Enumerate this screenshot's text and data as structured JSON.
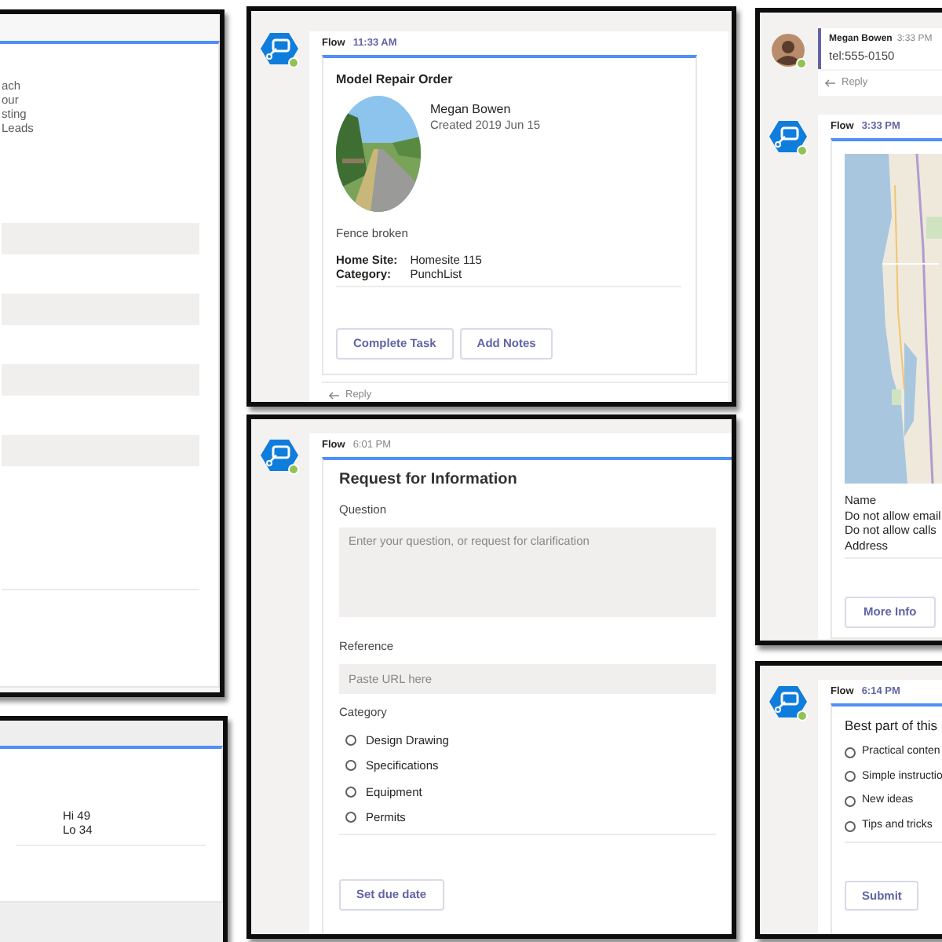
{
  "left_card": {
    "text_lines": [
      "ach",
      "our",
      "sting",
      "Leads"
    ],
    "fields": [
      {
        "kind": "input"
      },
      {
        "kind": "input"
      },
      {
        "kind": "input"
      },
      {
        "kind": "input"
      }
    ]
  },
  "weather_card": {
    "lines": [
      "Hi 49",
      "Lo 34"
    ]
  },
  "repair_card": {
    "sender": "Flow",
    "time": "11:33 AM",
    "time_highlighted": true,
    "title": "Model Repair Order",
    "person": "Megan Bowen",
    "created": "Created 2019 Jun 15",
    "description": "Fence broken",
    "facts": [
      {
        "label": "Home Site:",
        "value": "Homesite 115"
      },
      {
        "label": "Category:",
        "value": "PunchList"
      }
    ],
    "buttons": [
      "Complete Task",
      "Add Notes"
    ],
    "reply": "Reply"
  },
  "rfi_card": {
    "sender": "Flow",
    "time": "6:01 PM",
    "time_highlighted": false,
    "title": "Request for Information",
    "question_label": "Question",
    "question_placeholder": "Enter your question, or request for clarification",
    "reference_label": "Reference",
    "reference_placeholder": "Paste URL here",
    "category_label": "Category",
    "options": [
      {
        "label": "Design Drawing",
        "selected": false
      },
      {
        "label": "Specifications",
        "selected": false
      },
      {
        "label": "Equipment",
        "selected": false
      },
      {
        "label": "Permits",
        "selected": false
      }
    ],
    "button": "Set due date"
  },
  "contact_card": {
    "message": {
      "author": "Megan Bowen",
      "time": "3:33 PM",
      "text": "tel:555-0150",
      "reply": "Reply"
    },
    "sender": "Flow",
    "time": "3:33 PM",
    "time_highlighted": true,
    "lines": [
      "Name",
      "Do not allow email",
      "Do not allow calls",
      "Address"
    ],
    "button": "More Info"
  },
  "survey_card": {
    "sender": "Flow",
    "time": "6:14 PM",
    "time_highlighted": true,
    "title": "Best part of this",
    "options": [
      {
        "label": "Practical conten",
        "selected": false
      },
      {
        "label": "Simple instructio",
        "selected": false
      },
      {
        "label": "New ideas",
        "selected": false
      },
      {
        "label": "Tips and tricks",
        "selected": false
      }
    ],
    "button": "Submit"
  }
}
